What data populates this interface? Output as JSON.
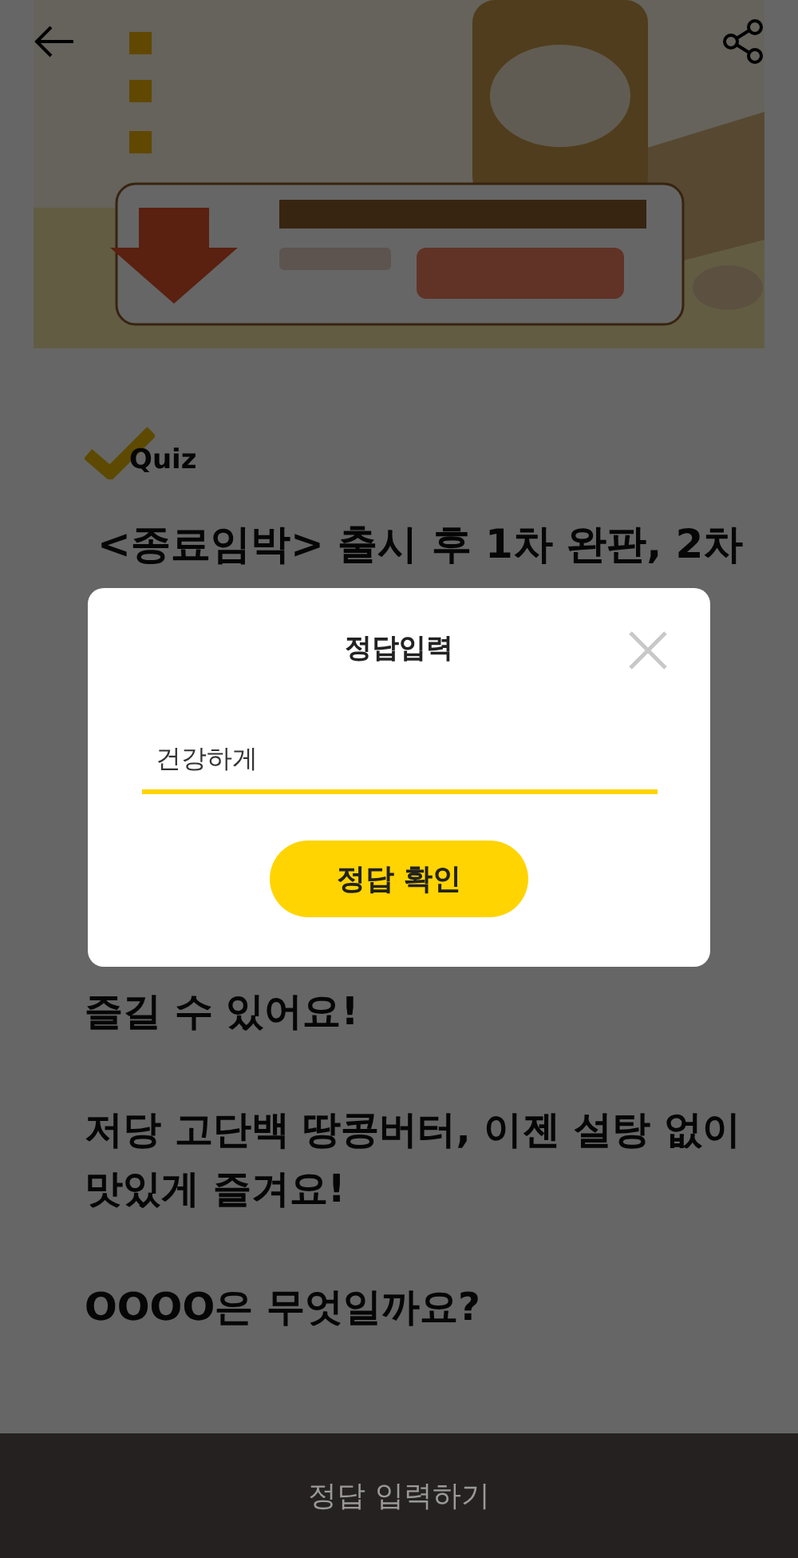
{
  "quiz": {
    "label": "Quiz",
    "first_line": "<종료임박> 출시 후 1차 완판, 2차",
    "paragraphs": [
      {
        "lines": [
          "즐길 수 있어요!"
        ]
      },
      {
        "lines": [
          "저당 고단백 땅콩버터, 이젠 설탕 없이",
          "맛있게 즐겨요!"
        ]
      },
      {
        "lines": [
          "OOOO은 무엇일까요?"
        ]
      }
    ]
  },
  "dialog": {
    "title": "정답입력",
    "answer": "건강하게",
    "confirm": "정답 확인"
  },
  "bottom_bar": {
    "label": "정답 입력하기"
  }
}
